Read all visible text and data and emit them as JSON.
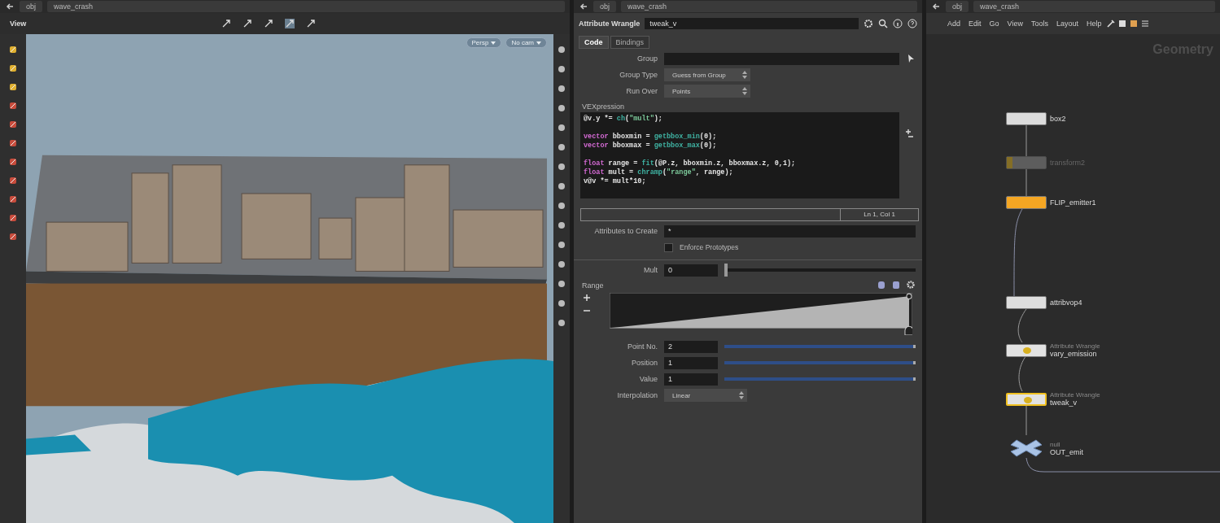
{
  "viewport": {
    "path": {
      "root": "obj",
      "node": "wave_crash"
    },
    "title": "View",
    "camera_buttons": [
      "Persp",
      "No cam"
    ]
  },
  "parameters": {
    "path": {
      "root": "obj",
      "node": "wave_crash"
    },
    "node_type": "Attribute Wrangle",
    "node_name": "tweak_v",
    "tabs": [
      {
        "label": "Code",
        "selected": true
      },
      {
        "label": "Bindings",
        "selected": false
      }
    ],
    "fields": [
      {
        "kind": "field",
        "label": "Group"
      },
      {
        "kind": "menu",
        "label": "Group Type",
        "value": "Guess from Group"
      },
      {
        "kind": "menu",
        "label": "Run Over",
        "value": "Points"
      }
    ],
    "code_label": "VEXpression",
    "code": [
      {
        "spaced": false,
        "tokens": [
          {
            "kind": "plain",
            "text": "@v.y *= "
          },
          {
            "kind": "function",
            "text": "ch"
          },
          {
            "kind": "plain",
            "text": "("
          },
          {
            "kind": "string",
            "text": "\"mult\""
          },
          {
            "kind": "plain",
            "text": ");"
          }
        ]
      },
      {
        "spaced": true,
        "tokens": [
          {
            "kind": "keyword",
            "text": "vector"
          },
          {
            "kind": "plain",
            "text": " bboxmin = "
          },
          {
            "kind": "function",
            "text": "getbbox_min"
          },
          {
            "kind": "plain",
            "text": "(0);"
          }
        ]
      },
      {
        "spaced": false,
        "tokens": [
          {
            "kind": "keyword",
            "text": "vector"
          },
          {
            "kind": "plain",
            "text": " bboxmax = "
          },
          {
            "kind": "function",
            "text": "getbbox_max"
          },
          {
            "kind": "plain",
            "text": "(0);"
          }
        ]
      },
      {
        "spaced": true,
        "tokens": [
          {
            "kind": "keyword",
            "text": "float"
          },
          {
            "kind": "plain",
            "text": " range = "
          },
          {
            "kind": "function",
            "text": "fit"
          },
          {
            "kind": "plain",
            "text": "(@P.z, bboxmin.z, bboxmax.z, 0,1);"
          }
        ]
      },
      {
        "spaced": false,
        "tokens": [
          {
            "kind": "keyword",
            "text": "float"
          },
          {
            "kind": "plain",
            "text": " mult = "
          },
          {
            "kind": "function",
            "text": "chramp"
          },
          {
            "kind": "plain",
            "text": "("
          },
          {
            "kind": "string",
            "text": "\"range\""
          },
          {
            "kind": "plain",
            "text": ", range);"
          }
        ]
      },
      {
        "spaced": false,
        "tokens": [
          {
            "kind": "plain",
            "text": "v@v *= mult*10;"
          }
        ]
      }
    ],
    "cursor_status": "Ln 1, Col 1",
    "attributes_to_create": {
      "label": "Attributes to Create",
      "value": "*"
    },
    "enforce_prototypes": {
      "label": "Enforce Prototypes",
      "checked": false
    },
    "mult": {
      "label": "Mult",
      "value": "0",
      "level": 0
    },
    "ramp_label": "Range",
    "ramp_params": [
      {
        "kind": "slider",
        "label": "Point No.",
        "value": "2",
        "level": 1
      },
      {
        "kind": "slider",
        "label": "Position",
        "value": "1",
        "level": 1
      },
      {
        "kind": "slider",
        "label": "Value",
        "value": "1",
        "level": 1
      },
      {
        "kind": "menu",
        "label": "Interpolation",
        "value": "Linear"
      }
    ]
  },
  "network": {
    "path": {
      "root": "obj",
      "node": "wave_crash"
    },
    "menu": [
      "Add",
      "Edit",
      "Go",
      "View",
      "Tools",
      "Layout",
      "Help"
    ],
    "title": "Geometry",
    "nodes": [
      {
        "kind": "box",
        "name": "box2",
        "selected": false,
        "bypassed": false
      },
      {
        "kind": "transform",
        "name": "transform2",
        "selected": false,
        "bypassed": true
      },
      {
        "kind": "flip",
        "name": "FLIP_emitter1",
        "selected": false,
        "bypassed": false
      },
      {
        "kind": "vop",
        "name": "attribvop4",
        "selected": false,
        "bypassed": false
      },
      {
        "kind": "wrangle",
        "type_label": "Attribute Wrangle",
        "name": "vary_emission",
        "selected": false,
        "bypassed": false
      },
      {
        "kind": "wrangle",
        "type_label": "Attribute Wrangle",
        "name": "tweak_v",
        "selected": true,
        "bypassed": false
      },
      {
        "kind": "null",
        "type_label": "null",
        "name": "OUT_emit",
        "selected": false,
        "bypassed": false
      }
    ]
  }
}
